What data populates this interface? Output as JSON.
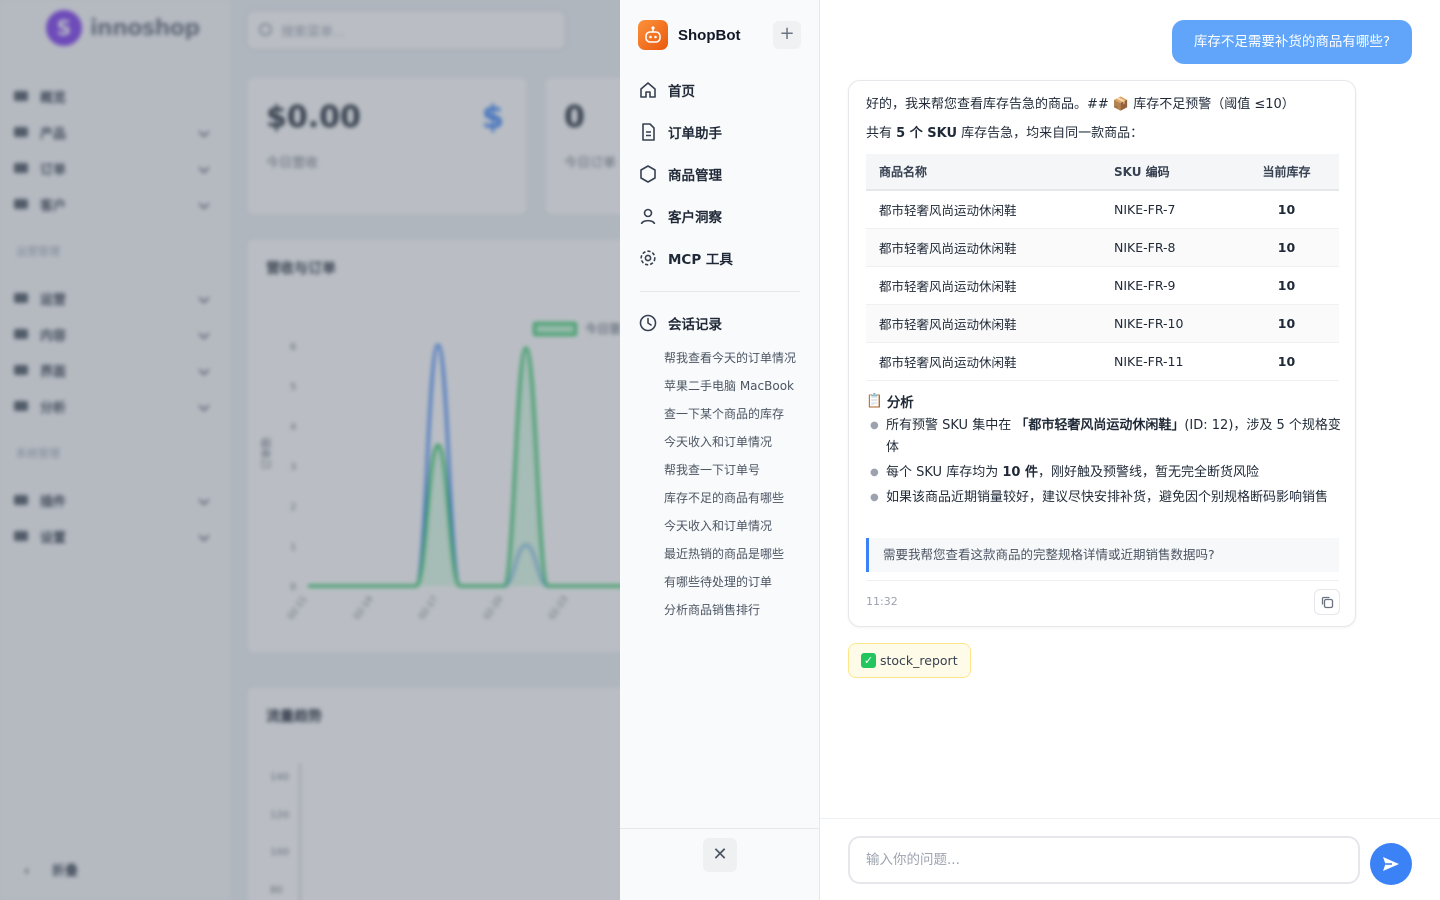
{
  "background": {
    "logo_text": "innoshop",
    "search_placeholder": "搜索菜单...",
    "menu": [
      {
        "label": "概览",
        "expandable": false
      },
      {
        "label": "产品",
        "expandable": true
      },
      {
        "label": "订单",
        "expandable": true
      },
      {
        "label": "客户",
        "expandable": true
      }
    ],
    "group_ops": "运营管理",
    "menu_ops": [
      {
        "label": "运营"
      },
      {
        "label": "内容"
      },
      {
        "label": "界面"
      },
      {
        "label": "分析"
      }
    ],
    "group_sys": "系统管理",
    "menu_sys": [
      {
        "label": "插件"
      },
      {
        "label": "设置"
      }
    ],
    "collapse_label": "折叠",
    "stats": [
      {
        "value": "$0.00",
        "label": "今日营收",
        "icon": "$"
      },
      {
        "value": "0",
        "label": "今日订单"
      }
    ],
    "chart1_title": "营收与订单",
    "chart1_legend": "今日营",
    "chart1_ylabel": "订单数",
    "chart1_yticks": [
      "6",
      "5",
      "4",
      "3",
      "2",
      "1",
      "0"
    ],
    "chart1_xticks": [
      "02-11",
      "02-14",
      "02-17",
      "02-20",
      "02-23"
    ],
    "chart2_title": "流量趋势",
    "chart2_yticks": [
      "140",
      "120",
      "100",
      "80"
    ]
  },
  "shopbot": {
    "brand": "ShopBot",
    "new_chat_label": "+",
    "nav": [
      {
        "label": "首页",
        "icon": "home-icon"
      },
      {
        "label": "订单助手",
        "icon": "document-icon"
      },
      {
        "label": "商品管理",
        "icon": "box-icon"
      },
      {
        "label": "客户洞察",
        "icon": "user-icon"
      },
      {
        "label": "MCP 工具",
        "icon": "gear-icon"
      }
    ],
    "history_title": "会话记录",
    "history": [
      "帮我查看今天的订单情况",
      "苹果二手电脑 MacBook",
      "查一下某个商品的库存",
      "今天收入和订单情况",
      "帮我查一下订单号",
      "库存不足的商品有哪些",
      "今天收入和订单情况",
      "最近热销的商品是哪些",
      "有哪些待处理的订单",
      "分析商品销售排行"
    ],
    "close_label": "✕"
  },
  "chat": {
    "user_message": "库存不足需要补货的商品有哪些?",
    "bot": {
      "line1": "好的，我来帮您查看库存告急的商品。## 📦 库存不足预警（阈值 ≤10）",
      "line2_pre": "共有 ",
      "line2_bold": "5 个 SKU",
      "line2_post": " 库存告急，均来自同一款商品：",
      "table_headers": [
        "商品名称",
        "SKU 编码",
        "当前库存"
      ],
      "table_rows": [
        [
          "都市轻奢风尚运动休闲鞋",
          "NIKE-FR-7",
          "10"
        ],
        [
          "都市轻奢风尚运动休闲鞋",
          "NIKE-FR-8",
          "10"
        ],
        [
          "都市轻奢风尚运动休闲鞋",
          "NIKE-FR-9",
          "10"
        ],
        [
          "都市轻奢风尚运动休闲鞋",
          "NIKE-FR-10",
          "10"
        ],
        [
          "都市轻奢风尚运动休闲鞋",
          "NIKE-FR-11",
          "10"
        ]
      ],
      "analysis_emoji": "📋",
      "analysis_title": "分析",
      "bullet1_pre": "所有预警 SKU 集中在 ",
      "bullet1_bold": "「都市轻奢风尚运动休闲鞋」",
      "bullet1_post": "(ID: 12)，涉及 5 个规格变体",
      "bullet2_pre": "每个 SKU 库存均为 ",
      "bullet2_bold": "10 件",
      "bullet2_post": "，刚好触及预警线，暂无完全断货风险",
      "bullet3": "如果该商品近期销量较好，建议尽快安排补货，避免因个别规格断码影响销售",
      "quote": "需要我帮您查看这款商品的完整规格详情或近期销售数据吗?",
      "time": "11:32"
    },
    "tool_badge": "stock_report",
    "input_placeholder": "输入你的问题...",
    "input_value": ""
  }
}
